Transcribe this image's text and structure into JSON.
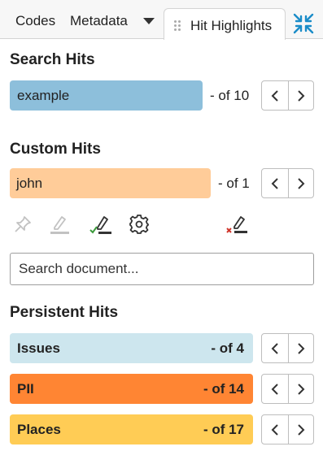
{
  "tabs": {
    "codes": "Codes",
    "metadata": "Metadata",
    "active": "Hit Highlights"
  },
  "search_hits": {
    "title": "Search Hits",
    "term": "example",
    "count": "- of 10",
    "color": "#8dbfdb"
  },
  "custom_hits": {
    "title": "Custom Hits",
    "term": "john",
    "count": "- of 1",
    "color": "#ffcc99",
    "tools": [
      "pin-icon",
      "highlighter-disabled-icon",
      "highlighter-check-icon",
      "gear-icon",
      "highlighter-remove-icon"
    ]
  },
  "search_document": {
    "placeholder": "Search document..."
  },
  "persistent_hits": {
    "title": "Persistent Hits",
    "items": [
      {
        "label": "Issues",
        "count": "- of 4",
        "color": "#cde6ee"
      },
      {
        "label": "PII",
        "count": "- of 14",
        "color": "#ff8533"
      },
      {
        "label": "Places",
        "count": "- of 17",
        "color": "#ffcc55"
      }
    ]
  },
  "colors": {
    "accent": "#1a8cc8",
    "check_green": "#3a9a3a",
    "remove_red": "#d0352b"
  }
}
